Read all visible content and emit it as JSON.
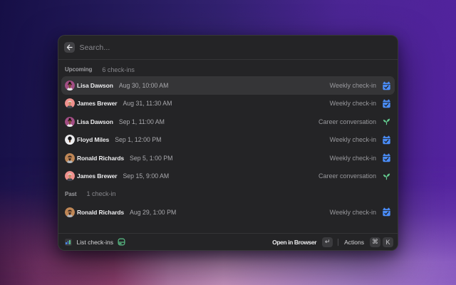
{
  "search": {
    "placeholder": "Search...",
    "back_icon": "arrow-left-icon"
  },
  "sections": [
    {
      "label": "Upcoming",
      "count_label": "6 check-ins"
    },
    {
      "label": "Past",
      "count_label": "1 check-in"
    }
  ],
  "rows": [
    {
      "section": 0,
      "name": "Lisa Dawson",
      "date": "Aug 30, 10:00 AM",
      "type": "Weekly check-in",
      "icon": "calendar-check-icon",
      "avatar": "lisa",
      "selected": true
    },
    {
      "section": 0,
      "name": "James Brewer",
      "date": "Aug 31, 11:30 AM",
      "type": "Weekly check-in",
      "icon": "calendar-check-icon",
      "avatar": "james",
      "selected": false
    },
    {
      "section": 0,
      "name": "Lisa Dawson",
      "date": "Sep 1, 11:00 AM",
      "type": "Career conversation",
      "icon": "sprout-icon",
      "avatar": "lisa",
      "selected": false
    },
    {
      "section": 0,
      "name": "Floyd Miles",
      "date": "Sep 1, 12:00 PM",
      "type": "Weekly check-in",
      "icon": "calendar-check-icon",
      "avatar": "floyd",
      "selected": false
    },
    {
      "section": 0,
      "name": "Ronald Richards",
      "date": "Sep 5, 1:00 PM",
      "type": "Weekly check-in",
      "icon": "calendar-check-icon",
      "avatar": "ronald",
      "selected": false
    },
    {
      "section": 0,
      "name": "James Brewer",
      "date": "Sep 15, 9:00 AM",
      "type": "Career conversation",
      "icon": "sprout-icon",
      "avatar": "james",
      "selected": false
    },
    {
      "section": 1,
      "name": "Ronald Richards",
      "date": "Aug 29, 1:00 PM",
      "type": "Weekly check-in",
      "icon": "calendar-check-icon",
      "avatar": "ronald",
      "selected": false
    }
  ],
  "footer": {
    "extension_label": "List check-ins",
    "open_label": "Open in Browser",
    "open_key": "↵",
    "actions_label": "Actions",
    "action_keys": [
      "⌘",
      "K"
    ]
  },
  "colors": {
    "type_icon_blue": "#4a8df8",
    "type_icon_green": "#63ca8e",
    "selected_row": "#353537",
    "panel": "#242426"
  },
  "avatars": {
    "lisa": {
      "bg": "#a34e85",
      "skin": "#7d4c34",
      "hair": "#1a1410",
      "shirt": "#e9e9ee"
    },
    "james": {
      "bg": "#f0918e",
      "skin": "#c28a60",
      "hair": "#dededd",
      "shirt": "#3c434e"
    },
    "floyd": {
      "bg": "#ebebed",
      "skin": "#64402c",
      "hair": "#17171a",
      "shirt": "#f4f4f6"
    },
    "ronald": {
      "bg": "#bf8756",
      "skin": "#8f5f3f",
      "hair": "#241d1a",
      "shirt": "#b3b8bf"
    }
  }
}
